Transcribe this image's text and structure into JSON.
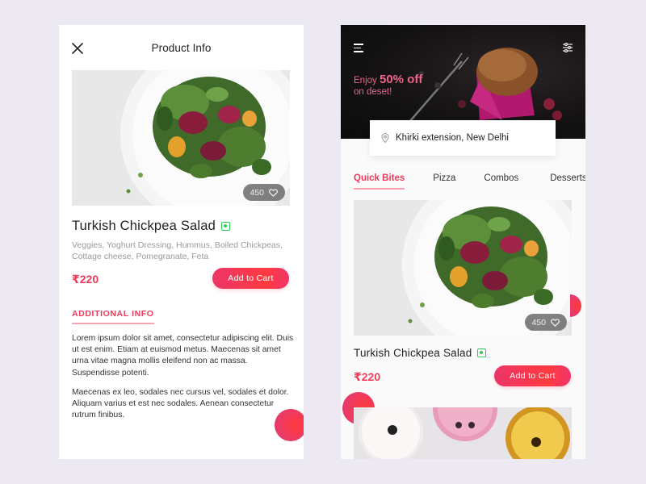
{
  "colors": {
    "accent": "#f03a5a",
    "accent_gradient_start": "#ec3568",
    "accent_gradient_end": "#ff3a3f",
    "veg_green": "#2ecc55",
    "background": "#ede9f3"
  },
  "product_info_screen": {
    "header": {
      "close_icon": "close-icon",
      "title": "Product Info"
    },
    "image": {
      "subject": "salad-plate",
      "likes": "450",
      "like_icon": "heart-outline-icon"
    },
    "product": {
      "name": "Turkish Chickpea Salad",
      "veg_icon": "veg-indicator-icon",
      "description": "Veggies, Yoghurt Dressing, Hummus, Boiled Chickpeas, Cottage cheese, Pomegranate, Feta",
      "price": "₹220",
      "cart_label": "Add to Cart"
    },
    "additional_info": {
      "heading": "ADDITIONAL INFO",
      "paragraphs": [
        "Lorem ipsum dolor sit amet, consectetur adipiscing elit. Duis ut est enim. Etiam at euismod metus. Maecenas sit amet urna vitae magna mollis eleifend non ac massa. Suspendisse potenti.",
        "Maecenas ex leo, sodales nec cursus vel, sodales et dolor. Aliquam varius et est nec sodales. Aenean consectetur rutrum finibus."
      ]
    }
  },
  "home_screen": {
    "header": {
      "menu_icon": "hamburger-menu-icon",
      "filter_icon": "filter-sliders-icon"
    },
    "promo": {
      "prefix": "Enjoy",
      "highlight": "50% off",
      "suffix": "on deset!"
    },
    "location": {
      "icon": "location-pin-icon",
      "text": "Khirki extension, New Delhi"
    },
    "tabs": [
      {
        "label": "Quick Bites",
        "active": true
      },
      {
        "label": "Pizza",
        "active": false
      },
      {
        "label": "Combos",
        "active": false
      },
      {
        "label": "Desserts",
        "active": false
      }
    ],
    "items": [
      {
        "name": "Turkish Chickpea Salad",
        "likes": "450",
        "price": "₹220",
        "cart_label": "Add to Cart"
      },
      {
        "subject": "donuts"
      }
    ]
  }
}
